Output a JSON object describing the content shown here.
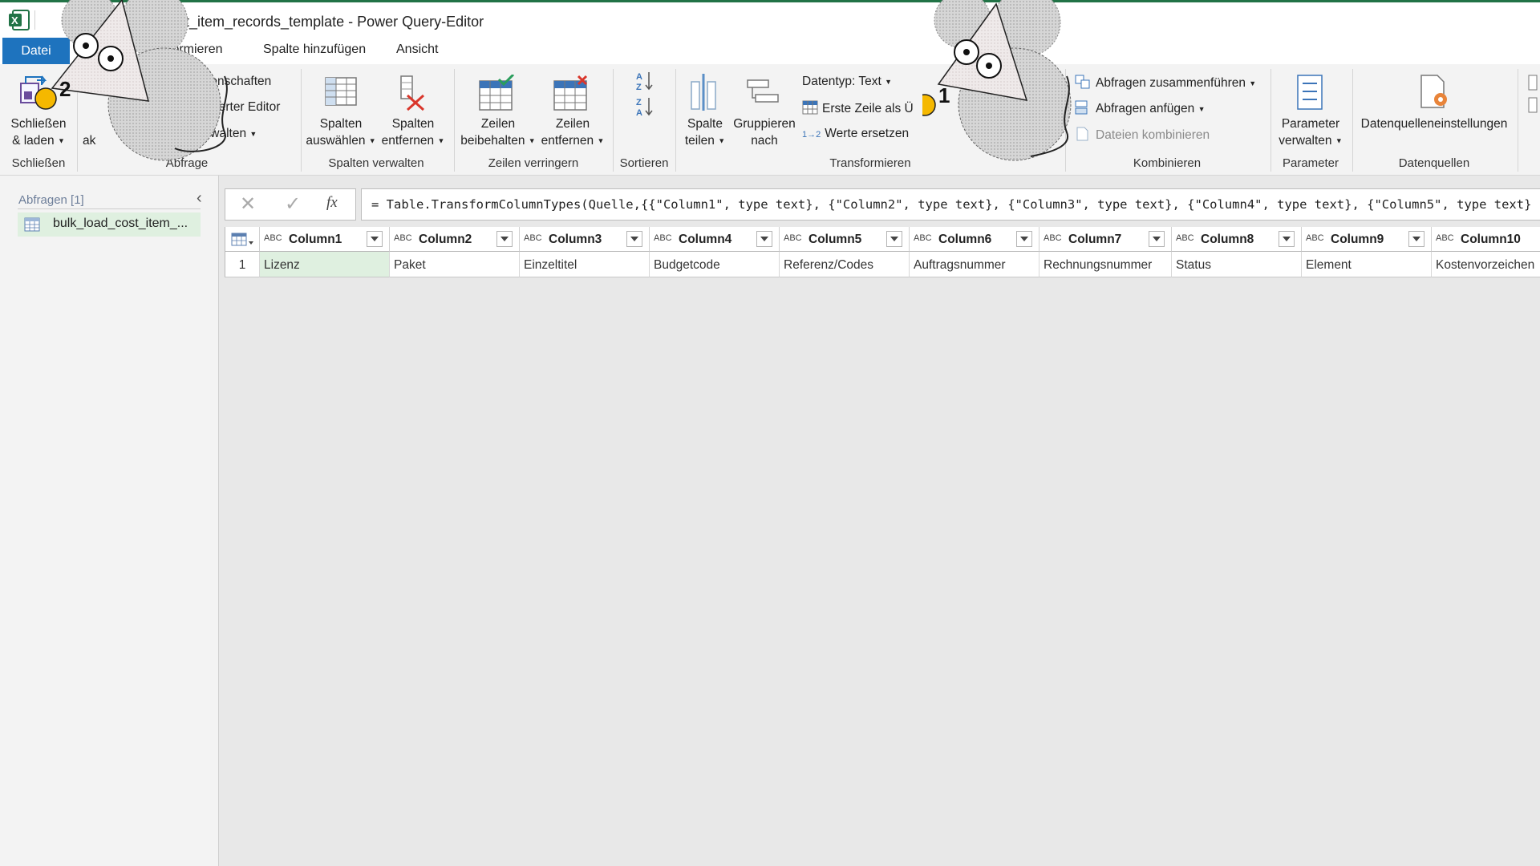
{
  "window": {
    "title": "ost_item_records_template - Power Query-Editor"
  },
  "tabs": {
    "file": "Datei",
    "items": [
      "formieren",
      "Spalte hinzufügen",
      "Ansicht"
    ]
  },
  "ribbon": {
    "close_load": {
      "line1": "Schließen",
      "line2": "& laden",
      "group": "Schließen"
    },
    "query": {
      "refresh_fragment": "ak",
      "properties": "Eigenschaften",
      "advanced_editor": "rweiterter Editor",
      "manage": "Verwalten",
      "group": "Abfrage"
    },
    "manage_columns": {
      "choose_l1": "Spalten",
      "choose_l2": "auswählen",
      "remove_l1": "Spalten",
      "remove_l2": "entfernen",
      "group": "Spalten verwalten"
    },
    "reduce_rows": {
      "keep_l1": "Zeilen",
      "keep_l2": "beibehalten",
      "remove_l1": "Zeilen",
      "remove_l2": "entfernen",
      "group": "Zeilen verringern"
    },
    "sort": {
      "group": "Sortieren"
    },
    "transform": {
      "split_l1": "Spalte",
      "split_l2": "teilen",
      "group_by_l1": "Gruppieren",
      "group_by_l2": "nach",
      "data_type": "Datentyp: Text",
      "first_row": "Erste Zeile als Ü",
      "replace_values": "Werte ersetzen",
      "group": "Transformieren"
    },
    "combine": {
      "merge": "Abfragen zusammenführen",
      "append": "Abfragen anfügen",
      "combine_files": "Dateien kombinieren",
      "group": "Kombinieren"
    },
    "parameters": {
      "l1": "Parameter",
      "l2": "verwalten",
      "group": "Parameter"
    },
    "datasources": {
      "settings": "Datenquelleneinstellungen",
      "group": "Datenquellen"
    }
  },
  "markers": {
    "one": "1",
    "two": "2"
  },
  "query_pane": {
    "header": "Abfragen [1]",
    "query_name": "bulk_load_cost_item_..."
  },
  "formula_bar": {
    "fx": "fx",
    "formula": "= Table.TransformColumnTypes(Quelle,{{\"Column1\", type text}, {\"Column2\", type text}, {\"Column3\", type text}, {\"Column4\", type text}, {\"Column5\", type text}"
  },
  "grid": {
    "type_icon": "ABC",
    "columns": [
      "Column1",
      "Column2",
      "Column3",
      "Column4",
      "Column5",
      "Column6",
      "Column7",
      "Column8",
      "Column9",
      "Column10"
    ],
    "rows": [
      {
        "num": "1",
        "cells": [
          "Lizenz",
          "Paket",
          "Einzeltitel",
          "Budgetcode",
          "Referenz/Codes",
          "Auftragsnummer",
          "Rechnungsnummer",
          "Status",
          "Element",
          "Kostenvorzeichen"
        ]
      }
    ]
  },
  "colors": {
    "accent": "#1e73be",
    "excel_green": "#217346",
    "selected_cell": "#dff0e0",
    "marker": "#f5b800"
  }
}
